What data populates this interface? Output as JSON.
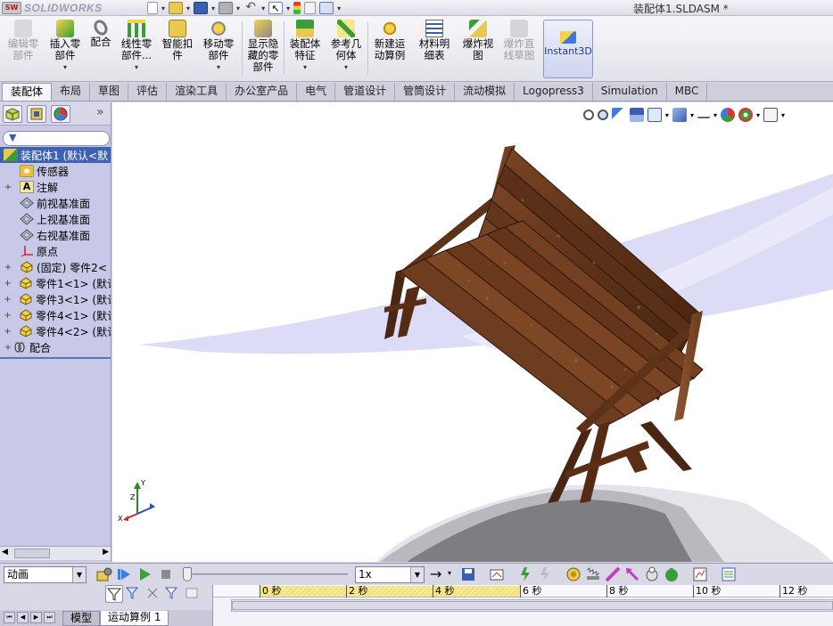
{
  "app": {
    "logo_text": "SOLIDWORKS",
    "logo_badge": "SW",
    "document_title": "装配体1.SLDASM *"
  },
  "ribbon": {
    "buttons": [
      {
        "label": "编辑零\n部件",
        "icon": "edit-component-icon",
        "disabled": true
      },
      {
        "label": "插入零\n部件",
        "icon": "insert-component-icon",
        "disabled": false
      },
      {
        "label": "配合",
        "icon": "mate-icon",
        "disabled": false
      },
      {
        "label": "线性零\n部件...",
        "icon": "linear-pattern-icon",
        "disabled": false
      },
      {
        "label": "智能扣\n件",
        "icon": "smart-fastener-icon",
        "disabled": false
      },
      {
        "label": "移动零\n部件",
        "icon": "move-component-icon",
        "disabled": false
      },
      {
        "label": "显示隐\n藏的零\n部件",
        "icon": "show-hidden-icon",
        "disabled": false
      },
      {
        "label": "装配体\n特征",
        "icon": "assembly-feature-icon",
        "disabled": false
      },
      {
        "label": "参考几\n何体",
        "icon": "reference-geometry-icon",
        "disabled": false
      },
      {
        "label": "新建运\n动算例",
        "icon": "new-motion-study-icon",
        "disabled": false
      },
      {
        "label": "材料明\n细表",
        "icon": "bom-icon",
        "disabled": false
      },
      {
        "label": "爆炸视\n图",
        "icon": "exploded-view-icon",
        "disabled": false
      },
      {
        "label": "爆炸直\n线草图",
        "icon": "explode-line-sketch-icon",
        "disabled": true
      }
    ],
    "instant3d_label": "Instant3D"
  },
  "tabs": [
    "装配体",
    "布局",
    "草图",
    "评估",
    "渲染工具",
    "办公室产品",
    "电气",
    "管道设计",
    "管筒设计",
    "流动模拟",
    "Logopress3",
    "Simulation",
    "MBC"
  ],
  "active_tab": "装配体",
  "tree": {
    "root_label": "装配体1  (默认<默",
    "items": [
      {
        "label": "传感器",
        "icon": "sensor-icon",
        "expand": ""
      },
      {
        "label": "注解",
        "icon": "annotation-icon",
        "expand": "+"
      },
      {
        "label": "前视基准面",
        "icon": "plane-icon",
        "expand": ""
      },
      {
        "label": "上视基准面",
        "icon": "plane-icon",
        "expand": ""
      },
      {
        "label": "右视基准面",
        "icon": "plane-icon",
        "expand": ""
      },
      {
        "label": "原点",
        "icon": "origin-icon",
        "expand": ""
      },
      {
        "label": "(固定) 零件2<",
        "icon": "part-icon",
        "expand": "+"
      },
      {
        "label": "零件1<1> (默认",
        "icon": "part-icon",
        "expand": "+"
      },
      {
        "label": "零件3<1> (默认",
        "icon": "part-icon",
        "expand": "+"
      },
      {
        "label": "零件4<1> (默认",
        "icon": "part-icon",
        "expand": "+"
      },
      {
        "label": "零件4<2> (默认",
        "icon": "part-icon",
        "expand": "+"
      },
      {
        "label": "配合",
        "icon": "mates-folder-icon",
        "expand": "+"
      }
    ]
  },
  "motion": {
    "study_type": "动画",
    "speed": "1x",
    "timeline_ticks": [
      "0 秒",
      "2 秒",
      "4 秒",
      "6 秒",
      "8 秒",
      "10 秒",
      "12 秒"
    ]
  },
  "bottom_tabs": [
    "模型",
    "运动算例 1"
  ],
  "triad": {
    "x": "X",
    "y": "Y",
    "z": "Z"
  }
}
